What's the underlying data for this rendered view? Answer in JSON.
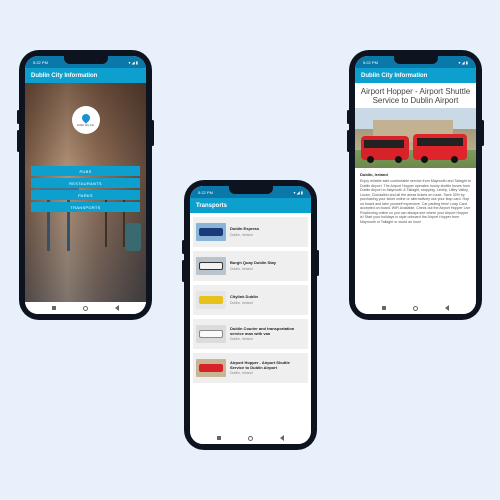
{
  "status": {
    "time": "5:22 PM",
    "icons": "▾ ◢ ▮"
  },
  "screen1": {
    "app_title": "Dublin City Information",
    "logo_text": "Dublin City Info",
    "menu": [
      "PUBS",
      "RESTAURANTS",
      "PARKS",
      "TRANSPORTS"
    ]
  },
  "screen2": {
    "app_title": "Transports",
    "items": [
      {
        "title": "Dublin Express",
        "subtitle": "Dublin, Ireland"
      },
      {
        "title": "Burgh Quay Dublin Stay",
        "subtitle": "Dublin, Ireland"
      },
      {
        "title": "Citylink Dublin",
        "subtitle": "Dublin, Ireland"
      },
      {
        "title": "Dublin Courier and transportation service man with van",
        "subtitle": "Dublin, Ireland"
      },
      {
        "title": "Airport Hopper - Airport Shuttle Service to Dublin Airport",
        "subtitle": "Dublin, Ireland"
      }
    ]
  },
  "screen3": {
    "app_title": "Dublin City Information",
    "title": "Airport Hopper - Airport Shuttle Service to Dublin Airport",
    "location": "Dublin, Ireland",
    "description": "Enjoy reliable safe comfortable service from Maynooth and Tallaght to Dublin Airport. The Airport Hopper operates hourly shuttle buses from Dublin Airport to Maynooth & Tallaght, stopping. Leixlip, Liffey Valley, Lucan, Clondalkin and all the areas tickets en route. Save 30% by purchasing your ticket online or alternatively use your leap card. Hop on board and take yourself expensive. Car parking fees! Leap Card accepted on board. WiFi Available. Check out the Airport Hopper Live Positioning online so you can always see where your Airport Hopper is! Start your holidays in style onboard the Airport Hopper from Maynooth or Tallaght or avoid an hour!"
  },
  "colors": {
    "statusbar": "#0a78a8",
    "appbar": "#0da0cf",
    "accent": "#0da0cf"
  }
}
